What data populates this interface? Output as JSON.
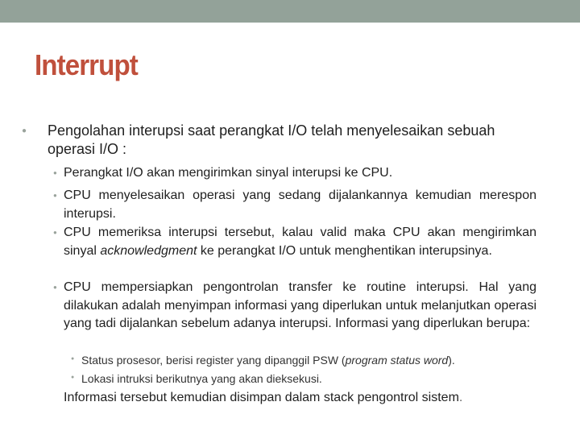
{
  "colors": {
    "top_band": "#93a299",
    "title": "#c0503c",
    "bullet": "#9aa39c",
    "text": "#1f1f1f"
  },
  "slide": {
    "title": "Interrupt",
    "main_bullet": "Pengolahan interupsi saat perangkat I/O telah menyelesaikan sebuah operasi I/O :",
    "sub_bullets": [
      {
        "text": "Perangkat I/O akan mengirimkan sinyal interupsi ke CPU."
      },
      {
        "text": "CPU menyelesaikan operasi yang sedang dijalankannya kemudian merespon interupsi."
      },
      {
        "before": "CPU memeriksa interupsi tersebut, kalau valid maka CPU akan mengirimkan sinyal ",
        "italic": "acknowledgment",
        "after": " ke perangkat I/O untuk menghentikan interupsinya."
      },
      {
        "text": "CPU mempersiapkan pengontrolan transfer ke routine interupsi. Hal yang dilakukan adalah menyimpan informasi yang diperlukan untuk melanjutkan operasi yang tadi dijalankan sebelum adanya interupsi. Informasi yang diperlukan berupa:"
      }
    ],
    "sub_sub_bullets": [
      {
        "before": "Status prosesor, berisi register yang dipanggil PSW (",
        "italic": "program status word",
        "after": ")."
      },
      {
        "text": "Lokasi intruksi berikutnya yang akan dieksekusi."
      }
    ],
    "closing_text": "Informasi tersebut kemudian disimpan dalam stack pengontrol sistem",
    "closing_period": "."
  }
}
